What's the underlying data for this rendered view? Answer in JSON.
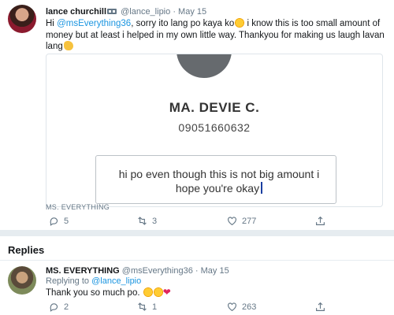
{
  "tweet": {
    "name": "lance churchill",
    "handle": "@lance_lipio",
    "dot": "·",
    "date": "May 15",
    "text_1": "Hi ",
    "mention": "@msEverything36",
    "text_2": ", sorry ito lang po kaya ko",
    "text_3": " i know this is too small amount of money but at least i helped in my own little way. Thankyou for making us laugh lavan lang",
    "card": {
      "profile_name": "MA. DEVIE C.",
      "phone": "09051660632",
      "message": "hi po even though this is not big amount i hope you're okay"
    },
    "source_label": "MS. EVERYTHING",
    "actions": {
      "replies": "5",
      "retweets": "3",
      "likes": "277"
    }
  },
  "replies_section": {
    "title": "Replies"
  },
  "reply": {
    "name": "MS. EVERYTHING",
    "handle": "@msEverything36",
    "dot": "·",
    "date": "May 15",
    "replying_prefix": "Replying to ",
    "replying_to": "@lance_lipio",
    "text": "Thank you so much po. ",
    "actions": {
      "replies": "2",
      "retweets": "1",
      "likes": "263"
    }
  },
  "colors": {
    "link": "#1b95e0",
    "muted": "#657786",
    "heart": "#e0245e",
    "divider": "#e6ecf0"
  },
  "icons": [
    "reply-icon",
    "retweet-icon",
    "like-icon",
    "share-icon",
    "verified-icon",
    "smile-emoji",
    "flex-emoji",
    "kiss-emoji",
    "heart-emoji"
  ]
}
